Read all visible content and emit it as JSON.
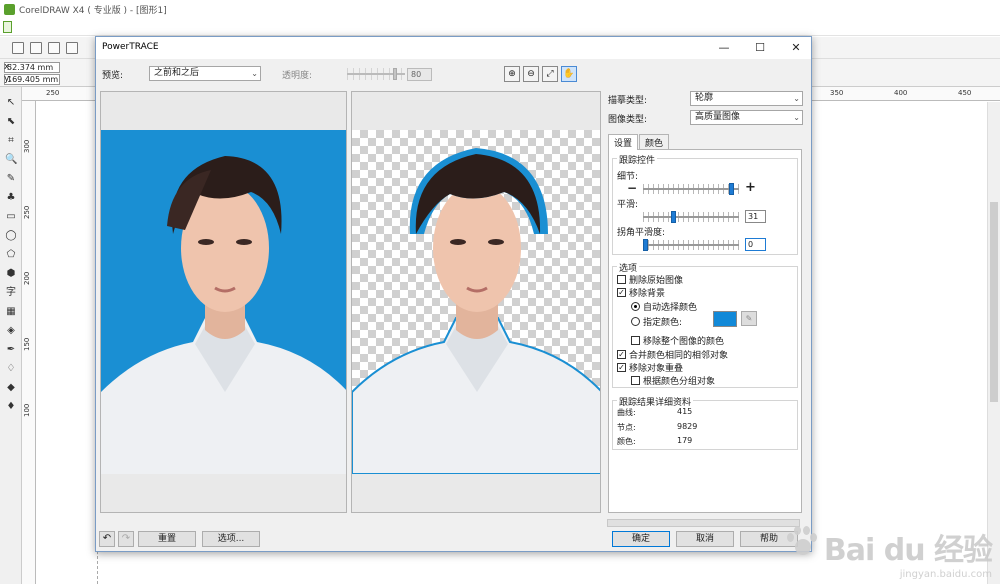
{
  "app": {
    "title": "CorelDRAW X4 ( 专业版 ) - [图形1]",
    "coords": {
      "x_label": "x:",
      "x_value": "52.374 mm",
      "y_label": "y:",
      "y_value": "169.405 mm"
    },
    "ruler_top": [
      "250",
      "350",
      "400",
      "450"
    ],
    "ruler_left": [
      "300",
      "250",
      "200",
      "150",
      "100"
    ],
    "tools": [
      "↖",
      "⬉",
      "⌗",
      "🔍",
      "✎",
      "♣",
      "▭",
      "◯",
      "⬠",
      "⬢",
      "字",
      "▦",
      "◈",
      "✒",
      "♢",
      "◆",
      "♦"
    ]
  },
  "dialog": {
    "title": "PowerTRACE",
    "minimize": "—",
    "maximize": "☐",
    "close": "✕",
    "preview_label": "预览:",
    "preview_value": "之前和之后",
    "transparency_label": "透明度:",
    "transparency_value": "80",
    "zoom_buttons": [
      "⊕",
      "⊖",
      "⤢",
      "✋"
    ],
    "trace_type_label": "描摹类型:",
    "trace_type_value": "轮廓",
    "image_type_label": "图像类型:",
    "image_type_value": "高质量图像",
    "tabs": [
      "设置",
      "颜色"
    ],
    "trace_controls": {
      "title": "跟踪控件",
      "detail_label": "细节:",
      "detail_minus": "−",
      "detail_plus": "+",
      "detail_level": 0.95,
      "smoothing_label": "平滑:",
      "smoothing_value": "31",
      "smoothing_level": 0.31,
      "corner_label": "拐角平滑度:",
      "corner_value": "0",
      "corner_level": 0.0
    },
    "options": {
      "title": "选项",
      "delete_original": "删除原始图像",
      "delete_original_checked": false,
      "remove_background": "移除背景",
      "remove_background_checked": true,
      "auto_select_color": "自动选择颜色",
      "specify_color": "指定颜色:",
      "specify_color_swatch": "#1189d8",
      "remove_entire_color": "移除整个图像的颜色",
      "remove_entire_checked": false,
      "merge_adjacent": "合并颜色相同的相邻对象",
      "merge_adjacent_checked": true,
      "remove_overlap": "移除对象重叠",
      "remove_overlap_checked": true,
      "group_by_color": "根据颜色分组对象",
      "group_by_color_checked": false
    },
    "results": {
      "title": "跟踪结果详细资料",
      "curves_label": "曲线:",
      "curves_value": "415",
      "nodes_label": "节点:",
      "nodes_value": "9829",
      "colors_label": "颜色:",
      "colors_value": "179"
    },
    "buttons": {
      "undo": "↶",
      "redo": "↷",
      "reset": "重置",
      "options": "选项...",
      "ok": "确定",
      "cancel": "取消",
      "help": "帮助"
    }
  },
  "watermark": {
    "brand": "Bai du 经验",
    "url": "jingyan.baidu.com"
  },
  "colors": {
    "photo_bg": "#1a8fd3",
    "accent": "#1e7bd4"
  }
}
